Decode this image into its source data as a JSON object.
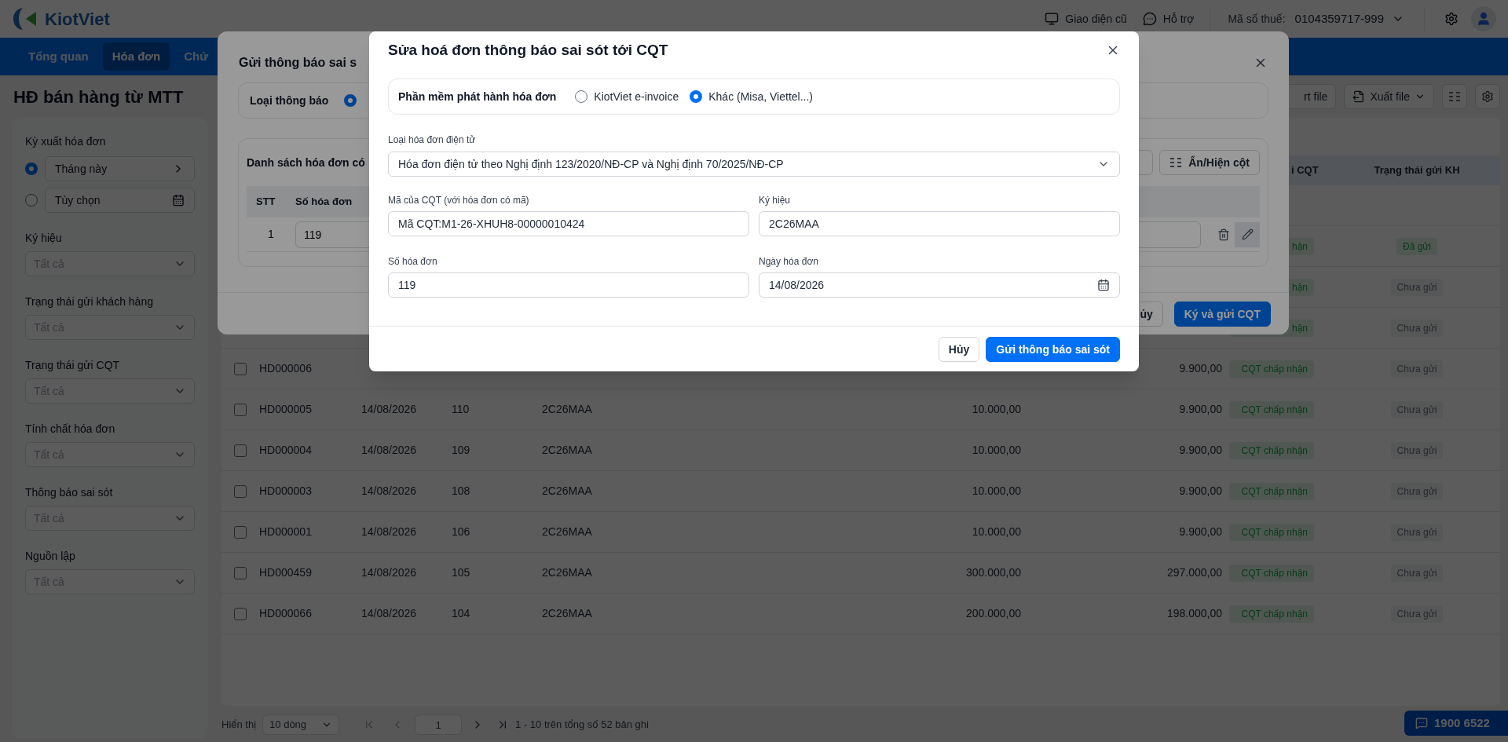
{
  "header": {
    "logo": "KiotViet",
    "links": [
      {
        "label": "Giao diện cũ",
        "kind": "monitor"
      },
      {
        "label": "Hỗ trợ",
        "kind": "chat"
      }
    ],
    "tax_label": "Mã số thuế:",
    "tax_value": "0104359717-999"
  },
  "nav": [
    {
      "label": "Tổng quan",
      "selected": false
    },
    {
      "label": "Hóa đơn",
      "selected": true
    },
    {
      "label": "Chứ",
      "selected": false
    }
  ],
  "page_title": "HĐ bán hàng từ MTT",
  "toolbar": [
    {
      "label": "rt file",
      "kind": "text"
    },
    {
      "label": "Xuất file",
      "kind": "export"
    },
    {
      "kind": "columns"
    },
    {
      "kind": "settings"
    }
  ],
  "filters": {
    "period": {
      "label": "Kỳ xuất hóa đơn",
      "options": [
        {
          "value": "Tháng này",
          "selected": true,
          "kind": "preset"
        },
        {
          "value": "Tùy chọn",
          "selected": false,
          "kind": "date"
        }
      ]
    },
    "selects": [
      {
        "label": "Ký hiệu",
        "placeholder": "Tất cả"
      },
      {
        "label": "Trạng thái gửi khách hàng",
        "placeholder": "Tất cả"
      },
      {
        "label": "Trạng thái gửi CQT",
        "placeholder": "Tất cả"
      },
      {
        "label": "Tính chất hóa đơn",
        "placeholder": "Tất cả"
      },
      {
        "label": "Thông báo sai sót",
        "placeholder": "Tất cả"
      },
      {
        "label": "Nguồn lập",
        "placeholder": "Tất cả"
      }
    ]
  },
  "table": {
    "cqt_header": "i CQT",
    "kh_header": "Trạng thái gửi KH",
    "rows": [
      {
        "cqt_status": "hận",
        "kh_status": "Đã gửi",
        "kh_sent": true
      },
      {
        "cqt_status": "hận",
        "kh_status": "Chưa gửi",
        "kh_sent": false
      },
      {
        "cqt_status": "hận",
        "kh_status": "Chưa gửi",
        "kh_sent": false
      },
      {
        "checked": false,
        "code": "HD000006",
        "total": "9.900,00",
        "cqt_status": "CQT chấp nhận",
        "kh_status": "Chưa gửi",
        "kh_sent": false
      },
      {
        "checked": false,
        "code": "HD000005",
        "date": "14/08/2026",
        "number": "110",
        "symbol": "2C26MAA",
        "amount": "10.000,00",
        "total": "9.900,00",
        "cqt_status": "CQT chấp nhận",
        "kh_status": "Chưa gửi",
        "kh_sent": false
      },
      {
        "checked": false,
        "code": "HD000004",
        "date": "14/08/2026",
        "number": "109",
        "symbol": "2C26MAA",
        "amount": "10.000,00",
        "total": "9.900,00",
        "cqt_status": "CQT chấp nhận",
        "kh_status": "Chưa gửi",
        "kh_sent": false
      },
      {
        "checked": false,
        "code": "HD000003",
        "date": "14/08/2026",
        "number": "108",
        "symbol": "2C26MAA",
        "amount": "10.000,00",
        "total": "9.900,00",
        "cqt_status": "CQT chấp nhận",
        "kh_status": "Chưa gửi",
        "kh_sent": false
      },
      {
        "checked": false,
        "code": "HD000001",
        "date": "14/08/2026",
        "number": "106",
        "symbol": "2C26MAA",
        "amount": "10.000,00",
        "total": "9.900,00",
        "cqt_status": "CQT chấp nhận",
        "kh_status": "Chưa gửi",
        "kh_sent": false
      },
      {
        "checked": false,
        "code": "HD000459",
        "date": "14/08/2026",
        "number": "105",
        "symbol": "2C26MAA",
        "amount": "300.000,00",
        "total": "297.000,00",
        "cqt_status": "CQT chấp nhận",
        "kh_status": "Chưa gửi",
        "kh_sent": false
      },
      {
        "checked": false,
        "code": "HD000066",
        "date": "14/08/2026",
        "number": "104",
        "symbol": "2C26MAA",
        "amount": "200.000,00",
        "total": "198.000,00",
        "cqt_status": "CQT chấp nhận",
        "kh_status": "Chưa gửi",
        "kh_sent": false
      }
    ]
  },
  "pagination": {
    "label": "Hiển thị",
    "page_size": "10 dòng",
    "page": "1",
    "summary": "1 - 10 trên tổng số 52 bản ghi"
  },
  "hotline": "1900 6522",
  "notice_modal": {
    "title": "Gửi thông báo sai s",
    "notice_type": {
      "label": "Loại thông báo",
      "options": [
        {
          "selected": true
        }
      ]
    },
    "list": {
      "title": "Danh sách hóa đơn có",
      "columns_button": "Ẩn/Hiện cột",
      "columns": [
        "STT",
        "Số hóa đơn"
      ],
      "rows": [
        {
          "index": "1",
          "number": "119"
        }
      ]
    },
    "buttons": [
      {
        "label": "ủy",
        "kind": "secondary"
      },
      {
        "label": "Ký và gửi CQT",
        "kind": "primary"
      }
    ]
  },
  "edit_modal": {
    "title": "Sửa hoá đơn thông báo sai sót tới CQT",
    "software": {
      "label": "Phần mềm phát hành hóa đơn",
      "options": [
        {
          "label": "KiotViet e-invoice",
          "selected": false
        },
        {
          "label": "Khác (Misa, Viettel...)",
          "selected": true
        }
      ]
    },
    "invoice_type": {
      "label": "Loại hóa đơn điện tử",
      "value": "Hóa đơn điện tử theo Nghị định 123/2020/NĐ-CP và Nghị định 70/2025/NĐ-CP"
    },
    "fields": [
      {
        "label": "Mã của CQT (với hóa đơn có mã)",
        "value": "Mã CQT:M1-26-XHUH8-00000010424",
        "kind": "text"
      },
      {
        "label": "Ký hiệu",
        "value": "2C26MAA",
        "kind": "text"
      },
      {
        "label": "Số hóa đơn",
        "value": "119",
        "kind": "text"
      },
      {
        "label": "Ngày hóa đơn",
        "value": "14/08/2026",
        "kind": "date"
      }
    ],
    "buttons": [
      {
        "label": "Hủy",
        "kind": "secondary"
      },
      {
        "label": "Gửi thông báo sai sót",
        "kind": "primary"
      }
    ]
  }
}
